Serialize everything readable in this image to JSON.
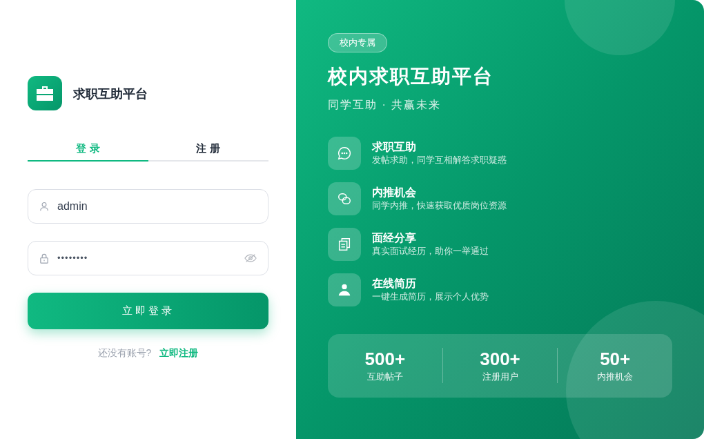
{
  "brand": {
    "title": "求职互助平台"
  },
  "tabs": [
    {
      "label": "登 录",
      "selected": true
    },
    {
      "label": "注 册",
      "selected": false
    }
  ],
  "username": {
    "value": "admin"
  },
  "password": {
    "value": "••••••••"
  },
  "login_button": "立即登录",
  "register_prompt": {
    "text": "还没有账号?",
    "link": "立即注册"
  },
  "badge": "校内专属",
  "hero_title": "校内求职互助平台",
  "hero_subtitle": "同学互助 · 共赢未来",
  "features": [
    {
      "title": "求职互助",
      "description": "发帖求助，同学互相解答求职疑惑"
    },
    {
      "title": "内推机会",
      "description": "同学内推，快速获取优质岗位资源"
    },
    {
      "title": "面经分享",
      "description": "真实面试经历，助你一举通过"
    },
    {
      "title": "在线简历",
      "description": "一键生成简历，展示个人优势"
    }
  ],
  "stats": [
    {
      "value": "500+",
      "label": "互助帖子"
    },
    {
      "value": "300+",
      "label": "注册用户"
    },
    {
      "value": "50+",
      "label": "内推机会"
    }
  ]
}
